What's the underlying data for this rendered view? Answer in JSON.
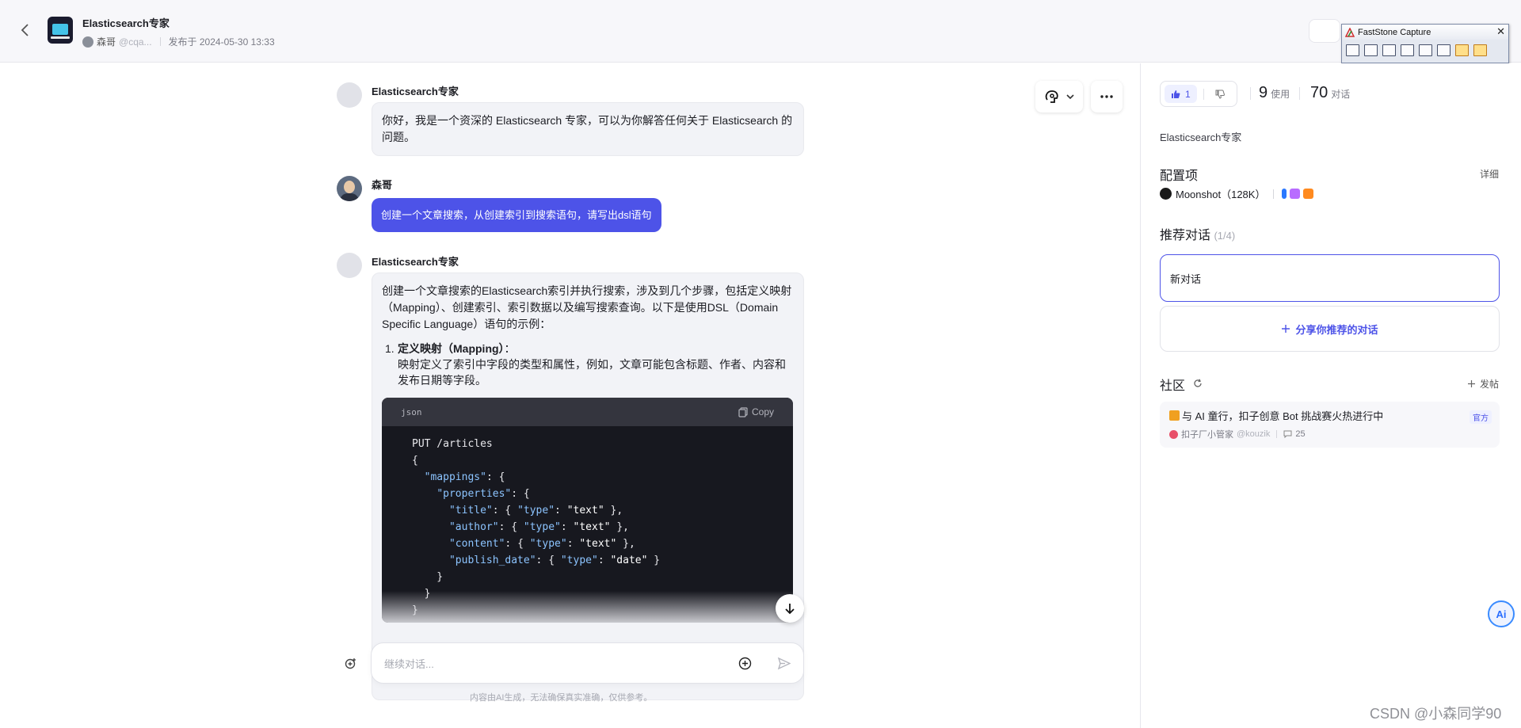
{
  "header": {
    "bot_name": "Elasticsearch专家",
    "author_name": "森哥",
    "author_handle": "@cqa...",
    "published": "发布于 2024-05-30 13:33"
  },
  "faststone": {
    "title": "FastStone Capture",
    "close": "✕"
  },
  "messages": {
    "m1": {
      "sender": "Elasticsearch专家",
      "text": "你好，我是一个资深的 Elasticsearch 专家，可以为你解答任何关于 Elasticsearch 的问题。"
    },
    "m2": {
      "sender": "森哥",
      "text": "创建一个文章搜索，从创建索引到搜索语句，请写出dsl语句"
    },
    "m3": {
      "sender": "Elasticsearch专家",
      "intro": "创建一个文章搜索的Elasticsearch索引并执行搜索，涉及到几个步骤，包括定义映射（Mapping）、创建索引、索引数据以及编写搜索查询。以下是使用DSL（Domain Specific Language）语句的示例：",
      "step1_num": "1.",
      "step1_title": "定义映射（Mapping）",
      "step1_colon": "：",
      "step1_desc": "映射定义了索引中字段的类型和属性，例如，文章可能包含标题、作者、内容和发布日期等字段。",
      "code_lang": "json",
      "copy_label": "Copy"
    }
  },
  "input": {
    "placeholder": "继续对话...",
    "disclaimer": "内容由AI生成，无法确保真实准确，仅供参考。"
  },
  "right_panel": {
    "likes": "1",
    "uses_num": "9",
    "uses_label": "使用",
    "chats_num": "70",
    "chats_label": "对话",
    "description": "Elasticsearch专家",
    "config_title": "配置项",
    "config_detail": "详细",
    "model": "Moonshot（128K）",
    "suggest_title": "推荐对话",
    "suggest_count": "(1/4)",
    "suggest_item": "新对话",
    "share_label": "分享你推荐的对话",
    "community_title": "社区",
    "post_label": "发帖",
    "post": {
      "title": "与 AI 童行，扣子创意 Bot 挑战赛火热进行中",
      "tag": "官方",
      "author": "扣子厂小管家",
      "handle": "@kouzik",
      "comments": "25"
    },
    "ai_fab": "Ai"
  },
  "watermark": "CSDN @小森同学90",
  "colors": {
    "accent": "#4d53e8",
    "code_bg": "#17181f",
    "bubble_bg": "#f2f3f7"
  }
}
